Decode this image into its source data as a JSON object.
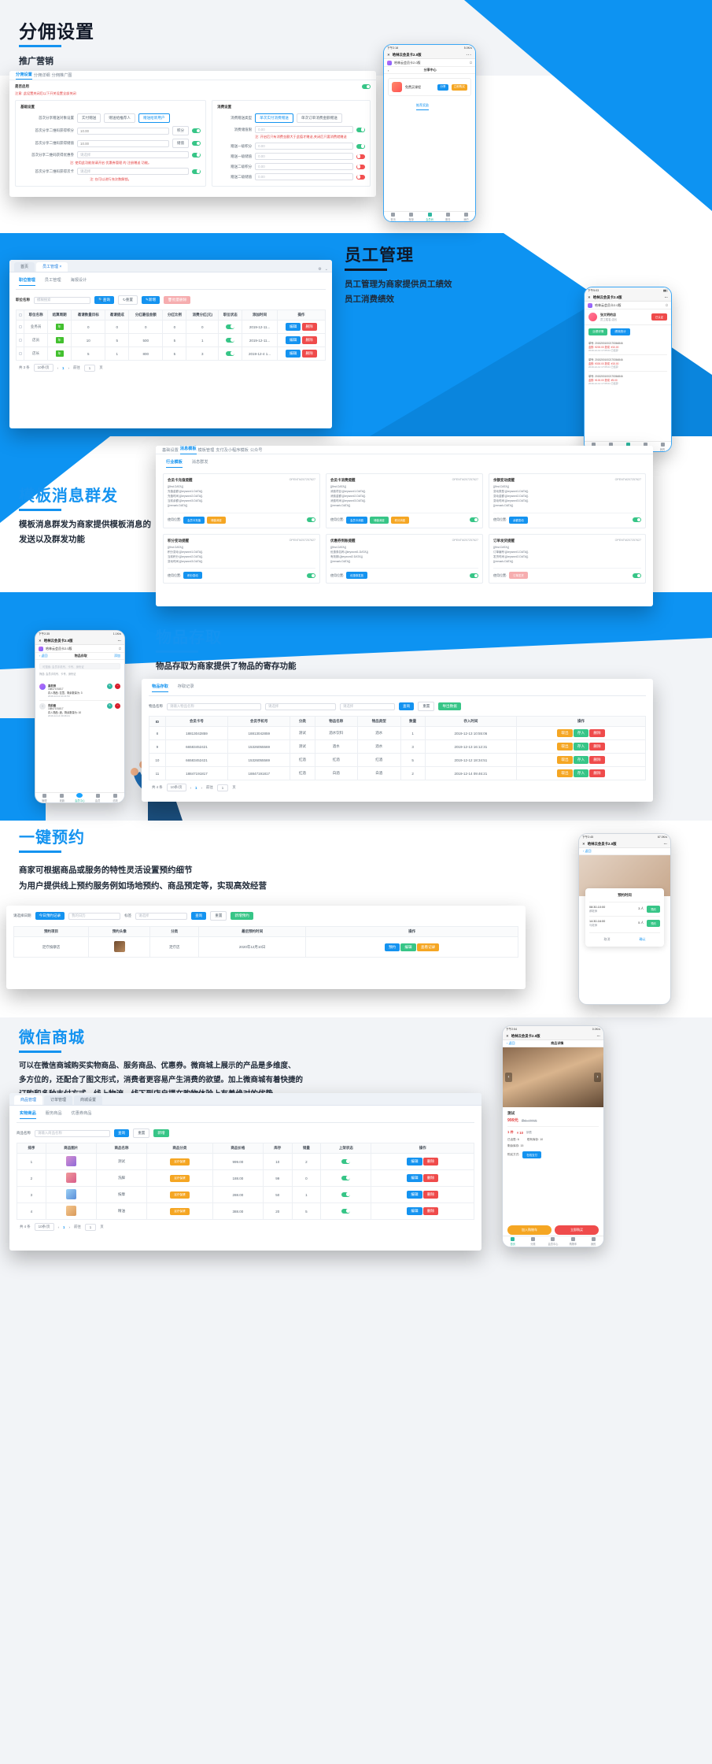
{
  "meta": {
    "brand_blue": "#1493f0",
    "dark_text": "#111827"
  },
  "sections": [
    {
      "id": "commission",
      "title": "分佣设置",
      "subtitle": "推广营销",
      "window": {
        "tabs": [
          "分佣设置",
          "分佣详细",
          "分佣推广图"
        ],
        "card_title": "是否启用",
        "warning": "注意: 此设置关闭后以下开关设置全部关闭",
        "left_panel": {
          "title": "基础设置",
          "rows": [
            {
              "label": "首次分享赠送对象设置",
              "radios": [
                "实付赠送",
                "赠送给推荐人",
                "赠送给新用户"
              ],
              "selected": 2
            },
            {
              "label": "首次分享二维码获得积分",
              "value": "10.00",
              "unit": "积分",
              "toggle": "on"
            },
            {
              "label": "首次分享二维码获得储值",
              "value": "10.00",
              "unit": "储值",
              "toggle": "on"
            },
            {
              "label": "首次分享二维码获得优惠券",
              "value": "请选择",
              "unit": "",
              "toggle": "on"
            }
          ],
          "hint1": "注: 使用此功能前请开启 优惠券管理 的 注册赠送 功能。",
          "last_row": {
            "label": "首次分享二维码获得次卡",
            "value": "请选择",
            "toggle": "on"
          },
          "hint2": "注: 仅可以进行充次数解锁。"
        },
        "right_panel": {
          "title": "消费设置",
          "rows": [
            {
              "label": "消费赠送类型",
              "radios": [
                "单次实付消费赠送",
                "单次订单消费金额赠送"
              ],
              "selected": 0
            },
            {
              "label": "消费储值限",
              "value": "0.00",
              "toggle": "on"
            },
            {
              "label": "赠送一级积分",
              "value": "0.00",
              "toggle": "on"
            },
            {
              "label": "赠送一级储值",
              "value": "0.00",
              "toggle": "off"
            },
            {
              "label": "赠送二级积分",
              "value": "0.00",
              "toggle": "off"
            },
            {
              "label": "赠送二级储值",
              "value": "0.00",
              "toggle": "off"
            }
          ],
          "hint": "注: 开启后只有消费金额大于此值才赠送,关闭后只要消费就赠送"
        }
      },
      "phone": {
        "status_time": "下午2:18",
        "status_right": "5.0K/s",
        "app_title": "哈林云会员卡2.0版",
        "account": "哈林云会员卡2.0版",
        "page_title": "分享中心",
        "card_name": "免费买课程",
        "card_btns": [
          "分享",
          "立即购买"
        ],
        "active_tab": "推荐奖励",
        "tabbar": [
          "首页",
          "账单",
          "会员码",
          "服务",
          "我的"
        ],
        "tabbar_active": 2
      }
    },
    {
      "id": "staff",
      "title": "员工管理",
      "desc_line1": "员工管理为商家提供员工绩效",
      "desc_line2": "员工消费绩效",
      "window": {
        "tabs": [
          "首页",
          "员工管理"
        ],
        "subtabs": [
          "职位管理",
          "员工管理",
          "海报设计"
        ],
        "search_label": "职位名称",
        "search_placeholder": "模糊搜索",
        "buttons": [
          "查询",
          "重置",
          "新增",
          "批量删除"
        ],
        "columns": [
          "职位名称",
          "结算周期",
          "邀请数量目标",
          "邀请提成",
          "分红最低金额",
          "分红比例",
          "消费分红(元)",
          "职位状态",
          "添加时间",
          "操作"
        ],
        "rows": [
          {
            "name": "业务员",
            "cycle": "年",
            "invite_target": "0",
            "invite_commission": "0",
            "min_bonus": "0",
            "bonus_ratio": "0",
            "consume_bonus": "0",
            "status": "on",
            "date": "2019-12-11...",
            "ops": [
              "编辑",
              "删除"
            ]
          },
          {
            "name": "店员",
            "cycle": "年",
            "invite_target": "10",
            "invite_commission": "5",
            "min_bonus": "500",
            "bonus_ratio": "5",
            "consume_bonus": "1",
            "status": "on",
            "date": "2019-12-11...",
            "ops": [
              "编辑",
              "删除"
            ]
          },
          {
            "name": "店长",
            "cycle": "年",
            "invite_target": "5",
            "invite_commission": "1",
            "min_bonus": "800",
            "bonus_ratio": "5",
            "consume_bonus": "3",
            "status": "on",
            "date": "2019-12-4 1...",
            "ops": [
              "编辑",
              "删除"
            ]
          }
        ],
        "pager": {
          "total": "共 3 条",
          "size": "10条/页",
          "page": "1",
          "goto": "前往",
          "goto_val": "1",
          "unit": "页"
        }
      },
      "phone": {
        "status_time": "下午5:03",
        "app_title": "哈林云会员卡2.0版",
        "account": "哈林云会员卡2.0版",
        "user_name": "张文明的店",
        "user_sub": "员工姓名:店长",
        "chips": [
          "业绩详情",
          "绩效统计"
        ],
        "records": [
          {
            "line1": "单号: 20152001002175364846",
            "line2": "金额: ¥200.00    提成: ¥10.00",
            "line3": "2019-12-12 17:05:04 已结算"
          },
          {
            "line1": "单号: 20152001002175364846",
            "line2": "金额: ¥300.00    提成: ¥15.00",
            "line3": "2019-12-12 17:05:04 已结算"
          },
          {
            "line1": "单号: 20152001002175364846",
            "line2": "金额: ¥100.00    提成: ¥5.00",
            "line3": "2019-12-12 17:05:04 已结算"
          }
        ],
        "tabbar": [
          "首页",
          "账单",
          "会员码",
          "服务",
          "我的"
        ],
        "tabbar_active": 2
      }
    },
    {
      "id": "template-msg",
      "title": "模板消息群发",
      "desc_line1": "模板消息群发为商家提供模板消息的",
      "desc_line2": "发送以及群发功能",
      "window": {
        "tabs": [
          "基础设置",
          "消息模板",
          "模板管理",
          "支付及小程序模板",
          "公众号"
        ],
        "subtabs": [
          "行业模板",
          "消息群发"
        ],
        "cards": [
          {
            "title": "会员卡充值提醒",
            "code": "OPENTM207257627",
            "lines": [
              "{{first.DATA}}",
              "充值金额:{{keyword1.DATA}}",
              "充值时间:{{keyword2.DATA}}",
              "当前余额:{{keyword3.DATA}}",
              "{{remark.DATA}}"
            ],
            "footer_label": "使用位置:",
            "chips": [
              "会员卡充值",
              "储值消费"
            ],
            "toggle": "on"
          },
          {
            "title": "会员卡消费提醒",
            "code": "OPENTM207257627",
            "lines": [
              "{{first.DATA}}",
              "消费项目:{{keyword1.DATA}}",
              "消费金额:{{keyword2.DATA}}",
              "消费时间:{{keyword3.DATA}}",
              "{{remark.DATA}}"
            ],
            "footer_label": "使用位置:",
            "chips": [
              "会员卡消费",
              "储值消费",
              "积分消费"
            ],
            "toggle": "on"
          },
          {
            "title": "余额变动提醒",
            "code": "OPENTM207257627",
            "lines": [
              "{{first.DATA}}",
              "变动类型:{{keyword1.DATA}}",
              "变动金额:{{keyword2.DATA}}",
              "变动时间:{{keyword3.DATA}}",
              "{{remark.DATA}}"
            ],
            "footer_label": "使用位置:",
            "chips": [
              "余额变动"
            ],
            "toggle": "on"
          },
          {
            "title": "积分变动提醒",
            "code": "OPENTM207257627",
            "lines": [
              "{{first.DATA}}",
              "积分变动:{{keyword1.DATA}}",
              "当前积分:{{keyword2.DATA}}",
              "变动时间:{{keyword3.DATA}}"
            ],
            "footer_label": "使用位置:",
            "chips": [
              "积分变动"
            ],
            "toggle": "on"
          },
          {
            "title": "优惠券到账提醒",
            "code": "OPENTM207257627",
            "lines": [
              "{{first.DATA}}",
              "优惠券名称:{{keyword1.DATA}}",
              "有效期:{{keyword2.DATA}}",
              "{{remark.DATA}}"
            ],
            "footer_label": "使用位置:",
            "chips": [
              "优惠券发放"
            ],
            "toggle": "on"
          },
          {
            "title": "订单发货提醒",
            "code": "OPENTM207257627",
            "lines": [
              "{{first.DATA}}",
              "订单编号:{{keyword1.DATA}}",
              "发货时间:{{keyword2.DATA}}",
              "{{remark.DATA}}"
            ],
            "footer_label": "使用位置:",
            "chips": [
              "订单发货"
            ],
            "toggle": "on"
          }
        ]
      }
    },
    {
      "id": "storage",
      "title": "物品存取",
      "desc": "物品存取为商家提供了物品的寄存功能",
      "phone": {
        "status_time": "下午2:35",
        "status_right": "1.1K/s",
        "app_title": "哈林云会员卡2.0版",
        "account": "哈林云会员卡2.0版",
        "back": "返回",
        "page_title": "物品存取",
        "add": "添加",
        "search_placeholder": "可搜索: 会员手机号、卡号、身份证",
        "filter_hint": "筛选: 会员手机号、卡号、身份证",
        "items": [
          {
            "name": "高老师",
            "phone": "18847191817",
            "detail": "存入物品: 拉罩，剩余数量为: 3",
            "time": "2019-12-11 10:21:53"
          },
          {
            "name": "向前看",
            "phone": "18847191817",
            "detail": "存入物品: 酒，剩余数量为: 10",
            "time": "2019-12-14 09:46:21"
          }
        ],
        "tabbar": [
          "管理",
          "收款",
          "会员中心",
          "会员",
          "绩效"
        ],
        "tabbar_active": 2
      },
      "window": {
        "subtabs": [
          "物品存取",
          "存取记录"
        ],
        "search_label": "物品名称",
        "search_placeholder": "请输入物品名称",
        "buttons": [
          "查询",
          "重置",
          "导出数据"
        ],
        "columns": [
          "ID",
          "会员卡号",
          "会员手机号",
          "分类",
          "物品名称",
          "物品类型",
          "数量",
          "存入时间",
          "操作"
        ],
        "rows": [
          {
            "id": "8",
            "card": "18813042859",
            "phone": "18813042859",
            "cat": "测试",
            "name": "酒水饮料",
            "type": "酒水",
            "qty": "1",
            "time": "2019-12-13 10:55:06",
            "ops": [
              "取出",
              "存入",
              "删除"
            ]
          },
          {
            "id": "9",
            "card": "66583452421",
            "phone": "15326055569",
            "cat": "测试",
            "name": "酒水",
            "type": "酒水",
            "qty": "3",
            "time": "2019-12-13 16:12:31",
            "ops": [
              "取出",
              "存入",
              "删除"
            ]
          },
          {
            "id": "10",
            "card": "66583452421",
            "phone": "15326055569",
            "cat": "红酒",
            "name": "红酒",
            "type": "红酒",
            "qty": "5",
            "time": "2019-12-12 18:34:51",
            "ops": [
              "取出",
              "存入",
              "删除"
            ]
          },
          {
            "id": "11",
            "card": "18847191817",
            "phone": "18847191817",
            "cat": "红酒",
            "name": "白酒",
            "type": "白酒",
            "qty": "2",
            "time": "2019-12-14 09:46:21",
            "ops": [
              "取出",
              "存入",
              "删除"
            ]
          }
        ],
        "pager": {
          "total": "共 4 条",
          "size": "10条/页",
          "page": "1",
          "goto": "前往",
          "goto_val": "1",
          "unit": "页"
        }
      }
    },
    {
      "id": "booking",
      "title": "一键预约",
      "desc_line1": "商家可根据商品或服务的特性灵活设置预约细节",
      "desc_line2": "为用户提供线上预约服务例如场地预约、商品预定等，实现高效经营",
      "window": {
        "search_label": "请选择日期",
        "filters": [
          "今日预约记录",
          "我的日历",
          "标签",
          "请选择"
        ],
        "buttons": [
          "查询",
          "重置",
          "新增预约"
        ],
        "columns": [
          "预约项目",
          "预约头像",
          "分类",
          "最后预约时间",
          "操作"
        ],
        "row": {
          "name": "足疗按摩店",
          "cat": "足疗店",
          "time": "2020年12月10日",
          "ops": [
            "预约",
            "编辑",
            "查看记录"
          ]
        }
      },
      "phone": {
        "status_time": "下午2:45",
        "status_right": "67.0K/s",
        "app_title": "哈林云会员卡2.0版",
        "back": "返回",
        "panel_title": "预约时间",
        "slots": [
          {
            "time": "08:30-10:00",
            "name": "郝老师",
            "qty": "3 人",
            "btn": "预约"
          },
          {
            "time": "14:30-16:00",
            "name": "马老师",
            "qty": "5 人",
            "btn": "预约"
          }
        ],
        "actions": [
          "取消",
          "确认"
        ]
      }
    },
    {
      "id": "mall",
      "title": "微信商城",
      "desc_line1": "可以在微信商城购买实物商品、服务商品、优惠券。微商城上展示的产品是多维度、",
      "desc_line2": "多方位的，还配合了图文形式，消费者更容易产生消费的欲望。加上微商城有着快捷的",
      "desc_line3": "订购和多种支付方式，线上物流、线下到店自提在购物体验上有着绝对的优势",
      "window": {
        "tabs": [
          "商品管理",
          "订单管理",
          "商城设置"
        ],
        "subtabs": [
          "实物商品",
          "服务商品",
          "优惠券商品"
        ],
        "search_label": "商品名称",
        "buttons": [
          "查询",
          "重置",
          "新增"
        ],
        "columns": [
          "排序",
          "商品图片",
          "商品名称",
          "商品分类",
          "商品价格",
          "库存",
          "销量",
          "上架状态",
          "操作"
        ],
        "rows": [
          {
            "sort": "1",
            "name": "测试",
            "cat": "足疗保健",
            "price": "999.00",
            "stock": "10",
            "sales": "2",
            "status": "on",
            "ops": [
              "编辑",
              "删除"
            ]
          },
          {
            "sort": "2",
            "name": "洗脚",
            "cat": "足疗保健",
            "price": "188.00",
            "stock": "99",
            "sales": "0",
            "status": "on",
            "ops": [
              "编辑",
              "删除"
            ]
          },
          {
            "sort": "3",
            "name": "按摩",
            "cat": "足疗保健",
            "price": "288.00",
            "stock": "50",
            "sales": "1",
            "status": "on",
            "ops": [
              "编辑",
              "删除"
            ]
          },
          {
            "sort": "4",
            "name": "精油",
            "cat": "足疗保健",
            "price": "388.00",
            "stock": "20",
            "sales": "5",
            "status": "on",
            "ops": [
              "编辑",
              "删除"
            ]
          }
        ],
        "pager": {
          "total": "共 4 条",
          "size": "10条/页",
          "page": "1",
          "goto": "前往",
          "goto_val": "1",
          "unit": "页"
        }
      },
      "phone": {
        "status_time": "下午2:54",
        "status_right": "0.0K/s",
        "app_title": "哈林云会员卡2.0版",
        "back": "返回",
        "page_title": "商品详情",
        "product_name": "测试",
        "price": "999元",
        "price_old": "原价: 1300元",
        "spec_qty": "1 件",
        "spec_unit": "× 10",
        "spec_label": "销售",
        "sold_label": "已出售:",
        "sold_value": "6",
        "stock_label": "现有库存:",
        "stock_value": "10",
        "left_label": "剩余库存: 15",
        "pay_label": "购买方式:",
        "pay_value": "在线支付",
        "btn_cart": "加入购物车",
        "btn_buy": "立即购买",
        "tabbar": [
          "首页",
          "分类",
          "会员中心",
          "购物车",
          "我的"
        ],
        "tabbar_active": 0
      }
    }
  ]
}
